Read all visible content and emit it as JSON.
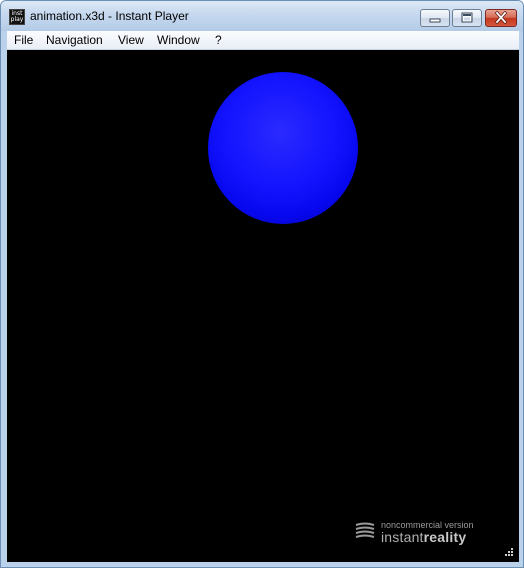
{
  "window": {
    "title": "animation.x3d - Instant Player",
    "icon_text_top": "inst",
    "icon_text_bottom": "play"
  },
  "menubar": {
    "items": [
      "File",
      "Navigation",
      "View",
      "Window",
      "?"
    ]
  },
  "viewport": {
    "background": "#000000",
    "sphere_color": "#1414ff"
  },
  "watermark": {
    "line1": "noncommercial version",
    "line2_light": "instant",
    "line2_bold": "reality"
  },
  "icons": [
    "app-icon",
    "minimize-icon",
    "maximize-icon",
    "close-icon",
    "instantreality-logo-icon",
    "resize-grip-icon"
  ]
}
